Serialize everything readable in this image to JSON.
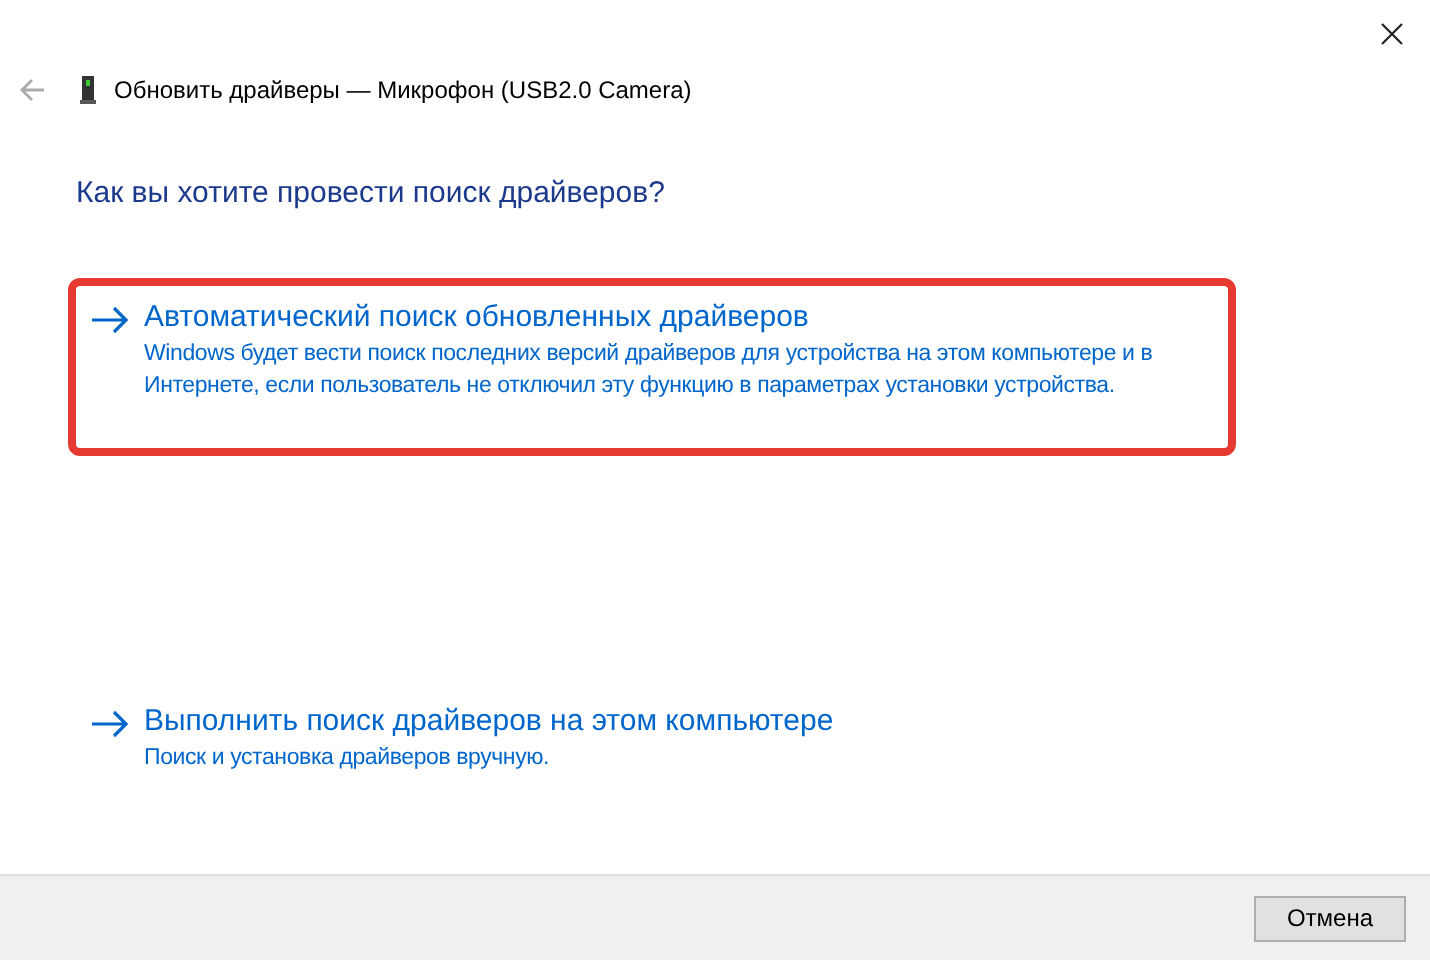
{
  "header": {
    "title": "Обновить драйверы — Микрофон (USB2.0 Camera)"
  },
  "heading": "Как вы хотите провести поиск драйверов?",
  "options": [
    {
      "title": "Автоматический поиск обновленных драйверов",
      "description": "Windows будет вести поиск последних версий драйверов для устройства на этом компьютере и в Интернете, если пользователь не отключил эту функцию в параметрах установки устройства.",
      "highlighted": true
    },
    {
      "title": "Выполнить поиск драйверов на этом компьютере",
      "description": "Поиск и установка драйверов вручную.",
      "highlighted": false
    }
  ],
  "buttons": [
    "Отмена"
  ]
}
